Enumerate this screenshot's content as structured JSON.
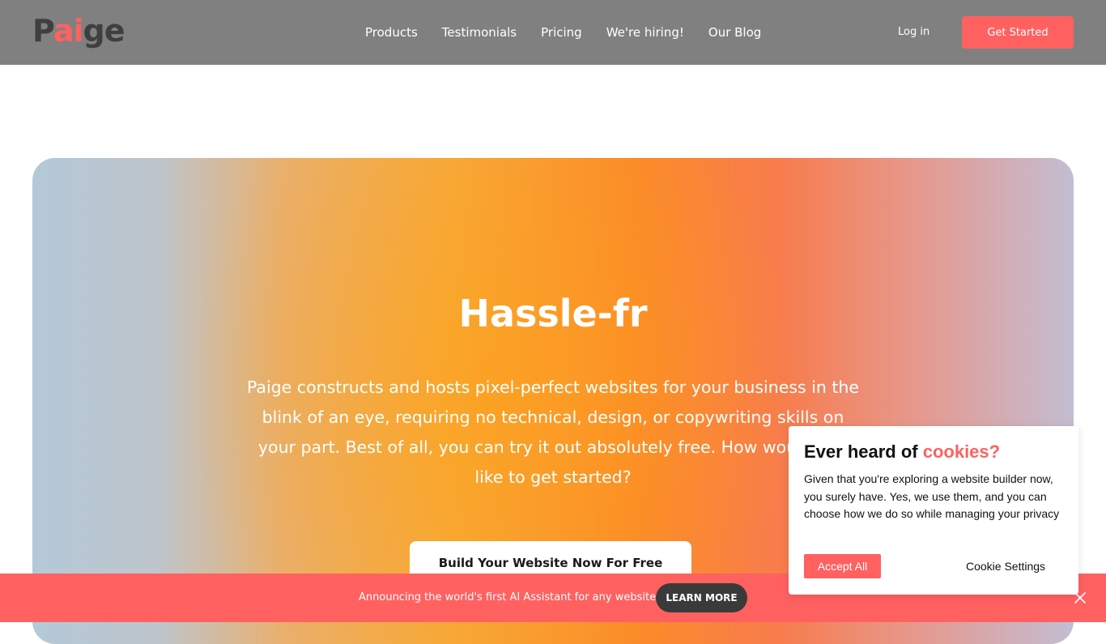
{
  "header": {
    "logo": {
      "part1": "P",
      "part2": "ai",
      "part3": "ge"
    },
    "nav": [
      "Products",
      "Testimonials",
      "Pricing",
      "We're hiring!",
      "Our Blog"
    ],
    "login_label": "Log in",
    "get_started_label": "Get Started"
  },
  "hero": {
    "title": "Hassle-fr",
    "text": "Paige constructs and hosts pixel-perfect websites for your business in the blink of an eye, requiring no technical, design, or copywriting skills on your part. Best of all, you can try it out absolutely free. How would you like to get started?",
    "cta_label": "Build Your Website Now For Free"
  },
  "cookie": {
    "title_prefix": "Ever heard of ",
    "title_highlight": "cookies?",
    "text": "Given that you're exploring a website builder now, you surely have. Yes, we use them, and you can choose how we do so while managing your privacy",
    "accept_label": "Accept All",
    "settings_label": "Cookie Settings"
  },
  "announcement": {
    "text": "Announcing the world's first AI Assistant for any website!",
    "button_label": "LEARN MORE"
  },
  "colors": {
    "header_bg": "#808080",
    "accent": "#ff6161",
    "dark_button": "#3a3a3a"
  },
  "icons": {
    "close": "close-icon"
  }
}
